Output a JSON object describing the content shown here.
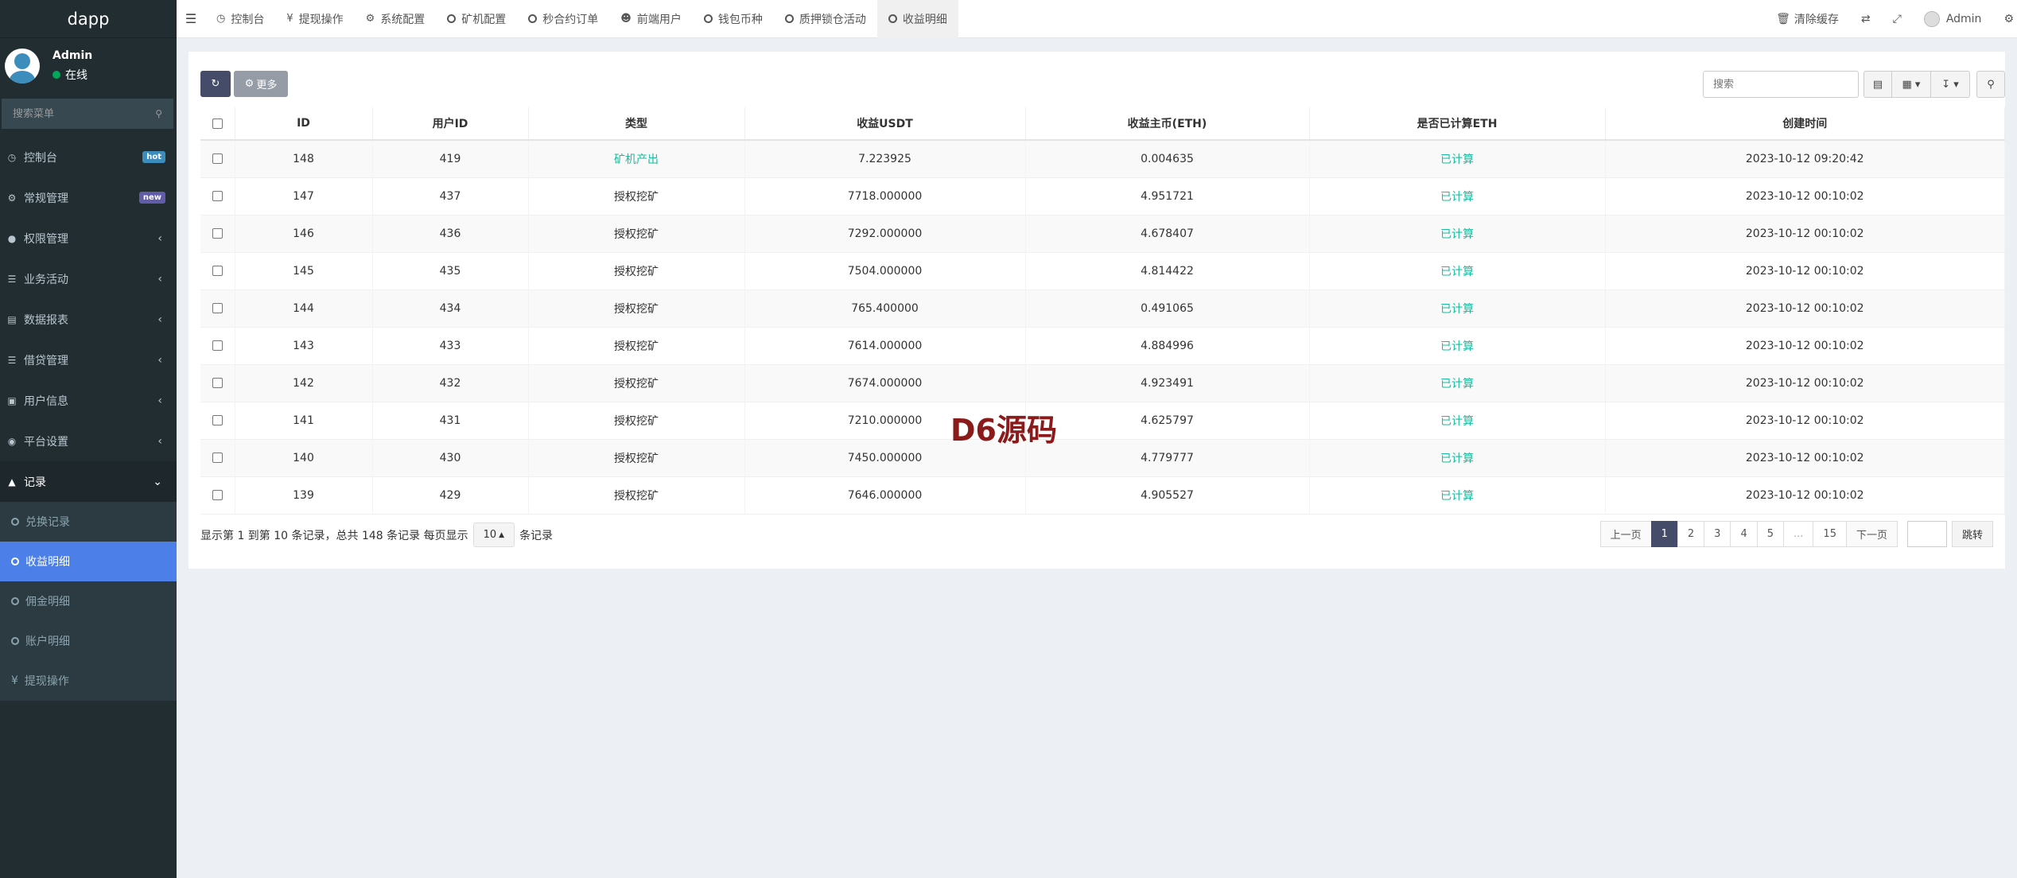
{
  "app": {
    "title": "dapp"
  },
  "user": {
    "name": "Admin",
    "status": "在线"
  },
  "sidebar": {
    "search_placeholder": "搜索菜单",
    "items": [
      {
        "label": "控制台",
        "icon": "dashboard-icon",
        "badge": "hot"
      },
      {
        "label": "常规管理",
        "icon": "cogs-icon",
        "badge": "new"
      },
      {
        "label": "权限管理",
        "icon": "group-icon"
      },
      {
        "label": "业务活动",
        "icon": "list-icon"
      },
      {
        "label": "数据报表",
        "icon": "file-icon"
      },
      {
        "label": "借贷管理",
        "icon": "list-icon"
      },
      {
        "label": "用户信息",
        "icon": "id-card-icon"
      },
      {
        "label": "平台设置",
        "icon": "cog-icon"
      },
      {
        "label": "记录",
        "icon": "chart-icon"
      }
    ],
    "sub_items": [
      "兑换记录",
      "收益明细",
      "佣金明细",
      "账户明细",
      "提现操作"
    ]
  },
  "tabs": [
    {
      "label": "控制台",
      "icon": "dashboard-icon"
    },
    {
      "label": "提现操作",
      "icon": "yen-icon"
    },
    {
      "label": "系统配置",
      "icon": "gear-icon"
    },
    {
      "label": "矿机配置",
      "icon": "circle-icon"
    },
    {
      "label": "秒合约订单",
      "icon": "circle-icon"
    },
    {
      "label": "前端用户",
      "icon": "user-circle-icon"
    },
    {
      "label": "钱包币种",
      "icon": "circle-icon"
    },
    {
      "label": "质押锁仓活动",
      "icon": "circle-icon"
    },
    {
      "label": "收益明细",
      "icon": "circle-icon"
    }
  ],
  "topright": {
    "clear_cache": "清除缓存",
    "admin": "Admin"
  },
  "toolbar": {
    "more": "更多",
    "search_placeholder": "搜索"
  },
  "table": {
    "headers": [
      "ID",
      "用户ID",
      "类型",
      "收益USDT",
      "收益主币(ETH)",
      "是否已计算ETH",
      "创建时间"
    ],
    "rows": [
      [
        "148",
        "419",
        "矿机产出",
        "7.223925",
        "0.004635",
        "已计算",
        "2023-10-12 09:20:42"
      ],
      [
        "147",
        "437",
        "授权挖矿",
        "7718.000000",
        "4.951721",
        "已计算",
        "2023-10-12 00:10:02"
      ],
      [
        "146",
        "436",
        "授权挖矿",
        "7292.000000",
        "4.678407",
        "已计算",
        "2023-10-12 00:10:02"
      ],
      [
        "145",
        "435",
        "授权挖矿",
        "7504.000000",
        "4.814422",
        "已计算",
        "2023-10-12 00:10:02"
      ],
      [
        "144",
        "434",
        "授权挖矿",
        "765.400000",
        "0.491065",
        "已计算",
        "2023-10-12 00:10:02"
      ],
      [
        "143",
        "433",
        "授权挖矿",
        "7614.000000",
        "4.884996",
        "已计算",
        "2023-10-12 00:10:02"
      ],
      [
        "142",
        "432",
        "授权挖矿",
        "7674.000000",
        "4.923491",
        "已计算",
        "2023-10-12 00:10:02"
      ],
      [
        "141",
        "431",
        "授权挖矿",
        "7210.000000",
        "4.625797",
        "已计算",
        "2023-10-12 00:10:02"
      ],
      [
        "140",
        "430",
        "授权挖矿",
        "7450.000000",
        "4.779777",
        "已计算",
        "2023-10-12 00:10:02"
      ],
      [
        "139",
        "429",
        "授权挖矿",
        "7646.000000",
        "4.905527",
        "已计算",
        "2023-10-12 00:10:02"
      ]
    ]
  },
  "footer": {
    "info_prefix": "显示第 1 到第 10 条记录，总共 148 条记录 每页显示",
    "page_size": "10",
    "info_suffix": "条记录",
    "pages": [
      "上一页",
      "1",
      "2",
      "3",
      "4",
      "5",
      "...",
      "15",
      "下一页"
    ],
    "jump": "跳转"
  },
  "watermark": "D6源码",
  "colors": {
    "sidebar": "#222d32",
    "active": "#4c7fe7",
    "green": "#18bc9c",
    "primary": "#444c69"
  }
}
